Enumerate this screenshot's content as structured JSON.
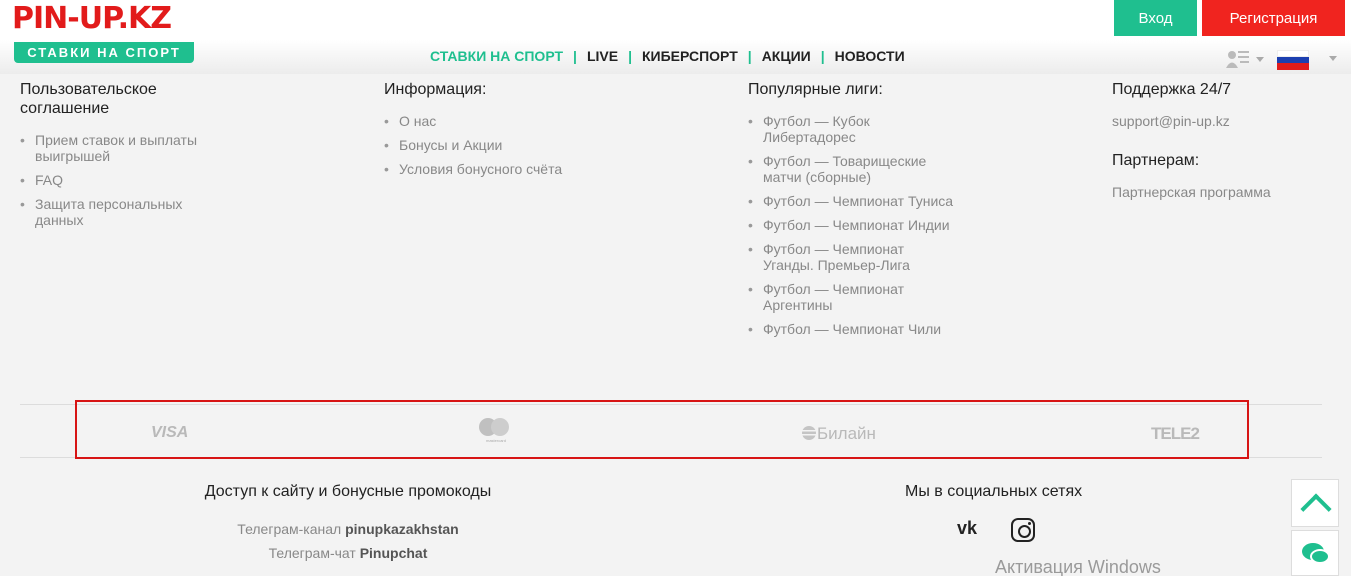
{
  "header": {
    "logo_main": "PIN-UP",
    "logo_tld": ".KZ",
    "logo_sub": "СТАВКИ НА СПОРТ",
    "login_label": "Вход",
    "register_label": "Регистрация",
    "nav": [
      "СТАВКИ НА СПОРТ",
      "LIVE",
      "КИБЕРСПОРТ",
      "АКЦИИ",
      "НОВОСТИ"
    ],
    "nav_active": 0
  },
  "footer": {
    "col1": {
      "title": "Пользовательское соглашение",
      "items": [
        "Прием ставок и выплаты выигрышей",
        "FAQ",
        "Защита персональных данных"
      ]
    },
    "col2": {
      "title": "Информация:",
      "items": [
        "О нас",
        "Бонусы и Акции",
        "Условия бонусного счёта"
      ]
    },
    "col3": {
      "title": "Популярные лиги:",
      "items": [
        "Футбол — Кубок Либертадорес",
        "Футбол — Товарищеские матчи (сборные)",
        "Футбол — Чемпионат Туниса",
        "Футбол — Чемпионат Индии",
        "Футбол — Чемпионат Уганды. Премьер-Лига",
        "Футбол — Чемпионат Аргентины",
        "Футбол — Чемпионат Чили"
      ]
    },
    "col4": {
      "title": "Поддержка 24/7",
      "email": "support@pin-up.kz",
      "partners_title": "Партнерам:",
      "partners_link": "Партнерская программа"
    },
    "payments": {
      "visa": "VISA",
      "mastercard": "mastercard",
      "beeline": "Билайн",
      "tele2": "TELE2"
    },
    "access": {
      "title": "Доступ к сайту и бонусные промокоды",
      "tg_channel_prefix": "Телеграм-канал",
      "tg_channel_name": "pinupkazakhstan",
      "tg_chat_prefix": "Телеграм-чат",
      "tg_chat_name": "Pinupchat"
    },
    "social": {
      "title": "Мы в социальных сетях",
      "vk": "vk"
    }
  },
  "watermark": "Активация Windows",
  "colors": {
    "brand_green": "#1fbf8f",
    "brand_red": "#f0241f",
    "highlight_red": "#d71414"
  },
  "icons": [
    "user-list-icon",
    "russia-flag-icon",
    "vk-icon",
    "instagram-icon",
    "scroll-up-icon",
    "chat-icon"
  ]
}
